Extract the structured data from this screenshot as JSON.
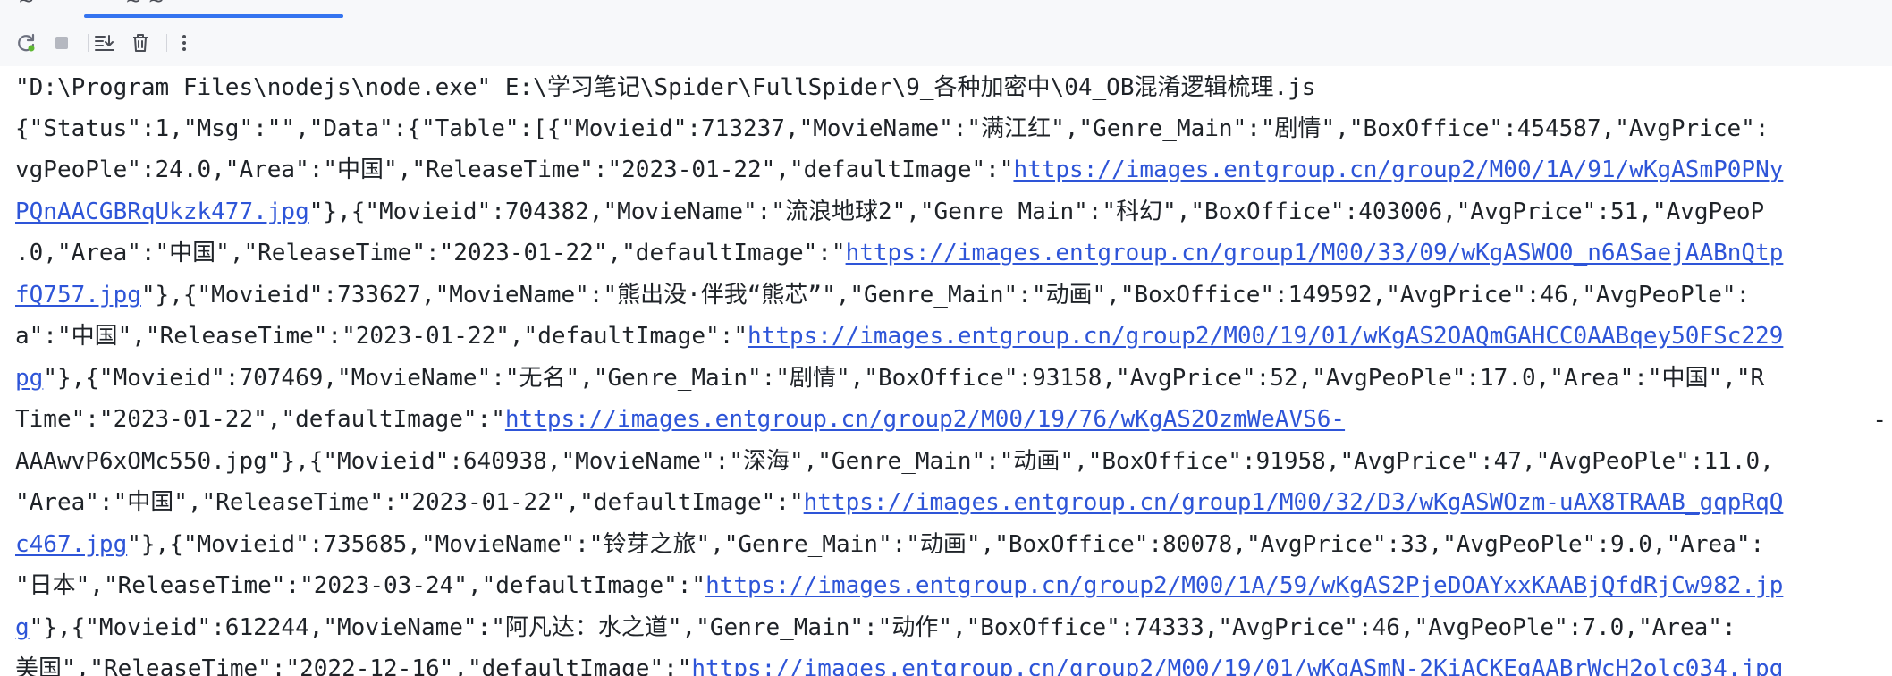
{
  "tabs": {
    "fragment_a": "~",
    "fragment_b": "~ ~"
  },
  "toolbar": {
    "buttons": [
      {
        "icon": "rerun-icon",
        "label": "Rerun"
      },
      {
        "icon": "stop-icon",
        "label": "Stop"
      },
      {
        "icon": "scroll-to-end-icon",
        "label": "Scroll to the end"
      },
      {
        "icon": "clear-all-icon",
        "label": "Clear All"
      },
      {
        "icon": "more-icon",
        "label": "More"
      }
    ],
    "accent_color": "#3574f0"
  },
  "console": {
    "lines": [
      {
        "text": "\"D:\\Program Files\\nodejs\\node.exe\" E:\\学习笔记\\Spider\\FullSpider\\9_各种加密中\\04_OB混淆逻辑梳理.js",
        "link": "",
        "after": ""
      },
      {
        "text": "{\"Status\":1,\"Msg\":\"\",\"Data\":{\"Table\":[{\"Movieid\":713237,\"MovieName\":\"满江红\",\"Genre_Main\":\"剧情\",\"BoxOffice\":454587,\"AvgPrice\":",
        "link": "",
        "after": ""
      },
      {
        "text": "vgPeoPle\":24.0,\"Area\":\"中国\",\"ReleaseTime\":\"2023-01-22\",\"defaultImage\":\"",
        "link": "https://images.entgroup.cn/group2/M00/1A/91/wKgASmP0PNy",
        "after": ""
      },
      {
        "text": "",
        "link": "PQnAACGBRqUkzk477.jpg",
        "after": "\"},{\"Movieid\":704382,\"MovieName\":\"流浪地球2\",\"Genre_Main\":\"科幻\",\"BoxOffice\":403006,\"AvgPrice\":51,\"AvgPeoP"
      },
      {
        "text": ".0,\"Area\":\"中国\",\"ReleaseTime\":\"2023-01-22\",\"defaultImage\":\"",
        "link": "https://images.entgroup.cn/group1/M00/33/09/wKgASWO0_n6ASaejAABnQtp",
        "after": ""
      },
      {
        "text": "",
        "link": "fQ757.jpg",
        "after": "\"},{\"Movieid\":733627,\"MovieName\":\"熊出没·伴我“熊芯”\",\"Genre_Main\":\"动画\",\"BoxOffice\":149592,\"AvgPrice\":46,\"AvgPeoPle\":"
      },
      {
        "text": "a\":\"中国\",\"ReleaseTime\":\"2023-01-22\",\"defaultImage\":\"",
        "link": "https://images.entgroup.cn/group2/M00/19/01/wKgAS2OAQmGAHCC0AABqey50FSc229",
        "after": ""
      },
      {
        "text": "",
        "link": "pg",
        "after": "\"},{\"Movieid\":707469,\"MovieName\":\"无名\",\"Genre_Main\":\"剧情\",\"BoxOffice\":93158,\"AvgPrice\":52,\"AvgPeoPle\":17.0,\"Area\":\"中国\",\"R"
      },
      {
        "text": "Time\":\"2023-01-22\",\"defaultImage\":\"",
        "link": "https://images.entgroup.cn/group2/M00/19/76/wKgAS2OzmWeAVS6-",
        "after": ""
      },
      {
        "text": "AAAwvP6xOMc550.jpg\"},{\"Movieid\":640938,\"MovieName\":\"深海\",\"Genre_Main\":\"动画\",\"BoxOffice\":91958,\"AvgPrice\":47,\"AvgPeoPle\":11.0,",
        "link": "",
        "after": ""
      },
      {
        "text": "\"Area\":\"中国\",\"ReleaseTime\":\"2023-01-22\",\"defaultImage\":\"",
        "link": "https://images.entgroup.cn/group1/M00/32/D3/wKgASWOzm-uAX8TRAAB_gqpRqQ",
        "after": ""
      },
      {
        "text": "",
        "link": "c467.jpg",
        "after": "\"},{\"Movieid\":735685,\"MovieName\":\"铃芽之旅\",\"Genre_Main\":\"动画\",\"BoxOffice\":80078,\"AvgPrice\":33,\"AvgPeoPle\":9.0,\"Area\":"
      },
      {
        "text": "\"日本\",\"ReleaseTime\":\"2023-03-24\",\"defaultImage\":\"",
        "link": "https://images.entgroup.cn/group2/M00/1A/59/wKgAS2PjeDOAYxxKAABjQfdRjCw982.jp",
        "after": ""
      },
      {
        "text": "",
        "link": "g",
        "after": "\"},{\"Movieid\":612244,\"MovieName\":\"阿凡达：水之道\",\"Genre_Main\":\"动作\",\"BoxOffice\":74333,\"AvgPrice\":46,\"AvgPeoPle\":7.0,\"Area\":"
      },
      {
        "text": "美国\",\"ReleaseTime\":\"2022-12-16\",\"defaultImage\":\"",
        "link": "https://images.entgroup.cn/group2/M00/19/01/wKgASmN-2KiACKEgAABrWcH2olc034.jpg",
        "after": ""
      }
    ],
    "wrap_marker": "-",
    "link_color": "#2e55d8"
  }
}
